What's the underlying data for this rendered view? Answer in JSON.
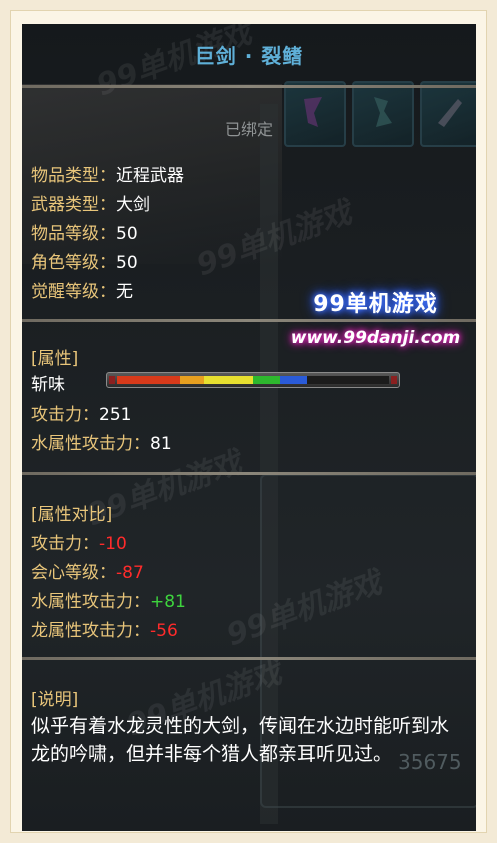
{
  "tooltip": {
    "title": "巨剑 · 裂鳍",
    "bound_status": "已绑定",
    "basic": [
      {
        "label": "物品类型：",
        "value": "近程武器"
      },
      {
        "label": "武器类型：",
        "value": "大剑"
      },
      {
        "label": "物品等级：",
        "value": "50"
      },
      {
        "label": "角色等级：",
        "value": "50"
      },
      {
        "label": "觉醒等级：",
        "value": "无"
      }
    ],
    "attributes": {
      "header": "[属性]",
      "sharpness_label": "斩味",
      "sharpness_segments": [
        {
          "color": "#d83a1a",
          "fraction": 0.23
        },
        {
          "color": "#e8a020",
          "fraction": 0.09
        },
        {
          "color": "#e8e030",
          "fraction": 0.18
        },
        {
          "color": "#2eb82e",
          "fraction": 0.1
        },
        {
          "color": "#2a5bd8",
          "fraction": 0.1
        }
      ],
      "stats": [
        {
          "label": "攻击力：",
          "value": "251"
        },
        {
          "label": "水属性攻击力：",
          "value": "81"
        }
      ]
    },
    "comparison": {
      "header": "[属性对比]",
      "stats": [
        {
          "label": "攻击力：",
          "value": "-10",
          "kind": "neg"
        },
        {
          "label": "会心等级：",
          "value": "-87",
          "kind": "neg"
        },
        {
          "label": "水属性攻击力：",
          "value": "+81",
          "kind": "pos"
        },
        {
          "label": "龙属性攻击力：",
          "value": "-56",
          "kind": "neg"
        }
      ]
    },
    "description": {
      "header": "[说明]",
      "text": "似乎有着水龙灵性的大剑，传闻在水边时能听到水龙的吟啸，但并非每个猎人都亲耳听见过。"
    }
  },
  "promo": {
    "line1": "99单机游戏",
    "line2": "www.99danji.com"
  },
  "background": {
    "partial_number": "35675"
  },
  "colors": {
    "title": "#5fb0d8",
    "label": "#e8c57a",
    "negative": "#ff2b2b",
    "positive": "#3ed43e"
  }
}
